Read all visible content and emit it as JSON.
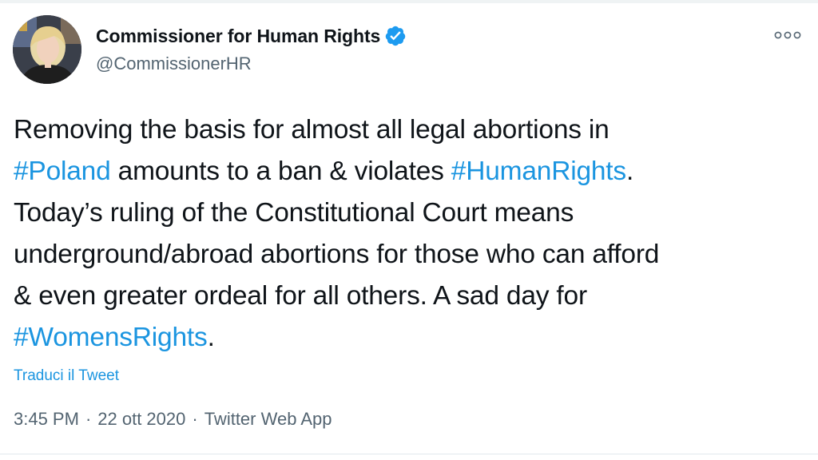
{
  "author": {
    "display_name": "Commissioner for Human Rights",
    "handle": "@CommissionerHR",
    "verified": true
  },
  "tweet": {
    "lines": [
      [
        {
          "text": "Removing the basis for almost all legal abortions in",
          "type": "text"
        }
      ],
      [
        {
          "text": "#Poland",
          "type": "hashtag"
        },
        {
          "text": " amounts to a ban & violates ",
          "type": "text"
        },
        {
          "text": "#HumanRights",
          "type": "hashtag"
        },
        {
          "text": ".",
          "type": "text"
        }
      ],
      [
        {
          "text": "Today’s ruling of the Constitutional Court means",
          "type": "text"
        }
      ],
      [
        {
          "text": "underground/abroad abortions for those who can afford",
          "type": "text"
        }
      ],
      [
        {
          "text": "& even greater ordeal for all others. A sad day for",
          "type": "text"
        }
      ],
      [
        {
          "text": "#WomensRights",
          "type": "hashtag"
        },
        {
          "text": ".",
          "type": "text"
        }
      ]
    ]
  },
  "translate_label": "Traduci il Tweet",
  "meta": {
    "time": "3:45 PM",
    "separator": "·",
    "date": "22 ott 2020",
    "source": "Twitter Web App"
  },
  "icons": {
    "verified": "verified-badge-icon",
    "more": "more-options-icon"
  },
  "colors": {
    "hashtag": "#1b95e0",
    "text": "#0f1419",
    "secondary": "#536471",
    "verified": "#1d9bf0"
  }
}
